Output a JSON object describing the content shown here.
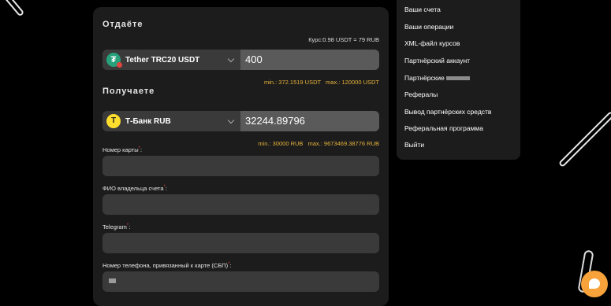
{
  "exchange": {
    "send_title": "Отдаёте",
    "rate": "Курс:0.98 USDT = 79 RUB",
    "send_currency": "Tether TRC20 USDT",
    "send_amount": "400",
    "send_min": "min.: 372.1519 USDT",
    "send_max": "max.: 120000 USDT",
    "receive_title": "Получаете",
    "receive_currency": "Т-Банк RUB",
    "receive_amount": "32244.89796",
    "receive_min": "min.: 30000 RUB",
    "receive_max": "max.: 9673469.38776 RUB"
  },
  "form": {
    "card_label": "Номер карты",
    "owner_label": "ФИО владельца счета",
    "telegram_label": "Telegram",
    "phone_label": "Номер телефона, привязанный к карте (СБП)",
    "required_mark": "*",
    "colon": ":"
  },
  "menu": {
    "items": [
      "Ваши счета",
      "Ваши операции",
      "XML-файл курсов",
      "Партнёрский аккаунт",
      "Партнёрские",
      "Рефералы",
      "Вывод партнёрских средств",
      "Реферальная программа",
      "Выйти"
    ]
  },
  "colors": {
    "accent": "#e7b33b",
    "chat": "#f7a23a",
    "usdt": "#26a17b",
    "tbank": "#ffdd2d"
  },
  "icons": [
    "tether-icon",
    "tbank-icon",
    "chevron-down-icon",
    "chat-icon"
  ]
}
